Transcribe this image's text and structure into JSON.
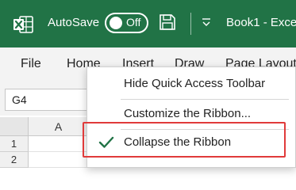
{
  "titlebar": {
    "autosave_label": "AutoSave",
    "autosave_state": "Off",
    "doc_title": "Book1  -  Exce",
    "bg_color": "#217346",
    "icons": [
      "excel-logo-icon",
      "save-icon",
      "qat-dropdown-icon"
    ]
  },
  "tabs": [
    "File",
    "Home",
    "Insert",
    "Draw",
    "Page Layout"
  ],
  "formula_bar": {
    "name_box": "G4"
  },
  "grid": {
    "columns": [
      "A"
    ],
    "rows": [
      "1",
      "2"
    ]
  },
  "context_menu": {
    "items": [
      {
        "label": "Hide Quick Access Toolbar",
        "checked": false
      },
      {
        "label": "Customize the Ribbon...",
        "checked": false
      },
      {
        "label": "Collapse the Ribbon",
        "checked": true
      }
    ],
    "check_color": "#217346",
    "highlight_color": "#e03a3a"
  }
}
